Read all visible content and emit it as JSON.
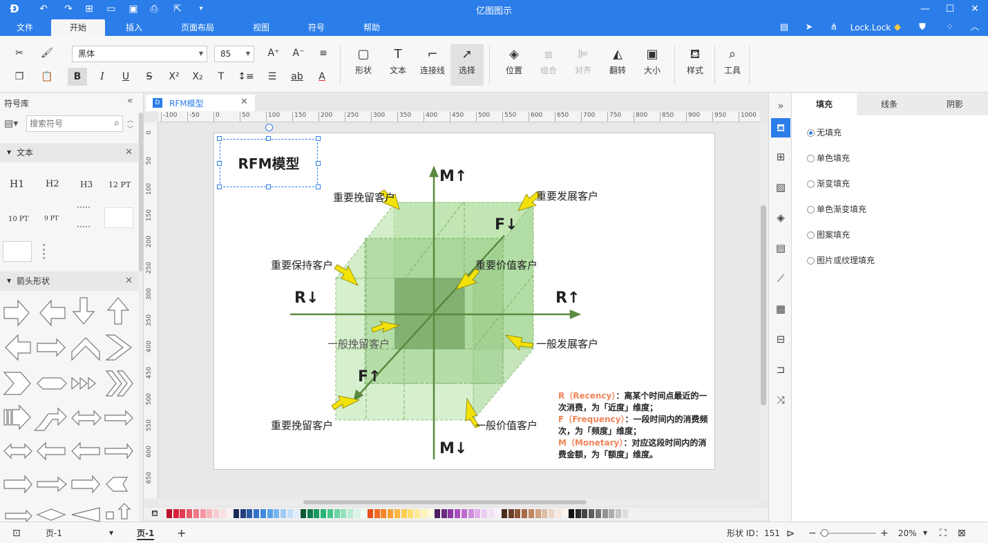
{
  "app": {
    "title": "亿图图示",
    "menu": [
      "文件",
      "开始",
      "插入",
      "页面布局",
      "视图",
      "符号",
      "帮助"
    ],
    "active_menu": "开始",
    "user": "Lock.Lock"
  },
  "ribbon": {
    "font_name": "黑体",
    "font_size": "85",
    "big_buttons": [
      {
        "id": "shape",
        "label": "形状"
      },
      {
        "id": "text",
        "label": "文本"
      },
      {
        "id": "connector",
        "label": "连接线"
      },
      {
        "id": "select",
        "label": "选择"
      },
      {
        "id": "position",
        "label": "位置"
      },
      {
        "id": "group",
        "label": "组合"
      },
      {
        "id": "align",
        "label": "对齐"
      },
      {
        "id": "flip",
        "label": "翻转"
      },
      {
        "id": "size",
        "label": "大小"
      },
      {
        "id": "style",
        "label": "样式"
      },
      {
        "id": "tools",
        "label": "工具"
      }
    ]
  },
  "left_panel": {
    "title": "符号库",
    "search_placeholder": "搜索符号",
    "sections": [
      {
        "name": "文本"
      },
      {
        "name": "箭头形状"
      }
    ],
    "text_symbols": [
      "H1",
      "H2",
      "H3",
      "12 PT",
      "10 PT",
      "9 PT"
    ]
  },
  "document": {
    "tab_label": "RFM模型",
    "ruler_h": [
      "-100",
      "-50",
      "0",
      "50",
      "100",
      "150",
      "200",
      "250",
      "300",
      "350",
      "400",
      "450",
      "500",
      "550",
      "600",
      "650",
      "700",
      "750",
      "800",
      "850",
      "900",
      "950",
      "1000"
    ],
    "ruler_v": [
      "0",
      "50",
      "100",
      "150",
      "200",
      "250",
      "300",
      "350",
      "400",
      "450",
      "500",
      "550",
      "600",
      "650"
    ]
  },
  "diagram": {
    "title": "RFM模型",
    "axes": {
      "m_up": "M↑",
      "m_down": "M↓",
      "r_left": "R↓",
      "r_right": "R↑",
      "f_top": "F↓",
      "f_bottom": "F↑"
    },
    "labels": {
      "retain_top": "重要挽留客户",
      "develop_top": "重要发展客户",
      "keep": "重要保持客户",
      "value": "重要价值客户",
      "general_retain": "一般挽留客户",
      "general_develop": "一般发展客户",
      "retain_bottom": "重要挽留客户",
      "general_value": "一般价值客户"
    },
    "legend": {
      "r_key": "R（Recency）",
      "r_text": "：离某个时间点最近的一次消费，为「近度」维度；",
      "f_key": "F（Frequency）",
      "f_text": "：一段时间内的消费频次，为「频度」维度；",
      "m_key": "M（Monetary）",
      "m_text": "：对应这段时间内的消费金额，为「额度」维度。"
    }
  },
  "right_panel": {
    "tabs": [
      "填充",
      "线条",
      "阴影"
    ],
    "active_tab": "填充",
    "fill_options": [
      "无填充",
      "单色填充",
      "渐变填充",
      "单色渐变填充",
      "图案填充",
      "图片或纹理填充"
    ],
    "selected_option": "无填充"
  },
  "status": {
    "page_selector": "页-1",
    "page_tab": "页-1",
    "shape_count_label": "形状 ID：",
    "shape_count": "151",
    "zoom": "20%"
  },
  "colors": {
    "accent": "#2b7de9",
    "cube_fill": "#a9dc98",
    "cube_dark": "#6f9f5e",
    "axis": "#5a8a3f",
    "arrow": "#f2e20a",
    "legend_key": "#f0845a"
  }
}
